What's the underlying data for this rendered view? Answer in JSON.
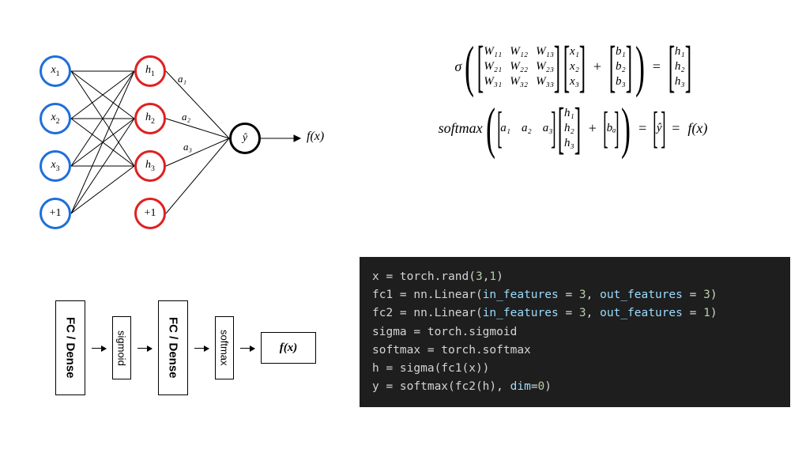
{
  "nn": {
    "input_layer": [
      {
        "label": "x",
        "sub": "1"
      },
      {
        "label": "x",
        "sub": "2"
      },
      {
        "label": "x",
        "sub": "3"
      },
      {
        "label": "+1",
        "sub": ""
      }
    ],
    "hidden_layer": [
      {
        "label": "h",
        "sub": "1"
      },
      {
        "label": "h",
        "sub": "2"
      },
      {
        "label": "h",
        "sub": "3"
      },
      {
        "label": "+1",
        "sub": ""
      }
    ],
    "output": {
      "label": "ŷ"
    },
    "edge_labels": {
      "a1": "a₁",
      "a2": "a₂",
      "a3": "a₃"
    },
    "output_label": "f(x)"
  },
  "blocks": {
    "fc1": "FC / Dense",
    "sigmoid": "sigmoid",
    "fc2": "FC / Dense",
    "softmax": "softmax",
    "out": "f(x)"
  },
  "eq": {
    "sigma": "σ",
    "softmax": "softmax",
    "W": [
      [
        "W₁₁",
        "W₁₂",
        "W₁₃"
      ],
      [
        "W₂₁",
        "W₂₂",
        "W₂₃"
      ],
      [
        "W₃₁",
        "W₃₂",
        "W₃₃"
      ]
    ],
    "x": [
      "x₁",
      "x₂",
      "x₃"
    ],
    "b": [
      "b₁",
      "b₂",
      "b₃"
    ],
    "h": [
      "h₁",
      "h₂",
      "h₃"
    ],
    "a": [
      "a₁",
      "a₂",
      "a₃"
    ],
    "ba": "bₐ",
    "yhat": "ŷ",
    "fx": "f(x)",
    "plus": "+",
    "eq": "="
  },
  "code": {
    "l1_a": "x = torch.rand(",
    "l1_b": "3",
    "l1_c": ",",
    "l1_d": "1",
    "l1_e": ")",
    "l2_a": "fc1 = nn.Linear(",
    "l2_b": "in_features",
    "l2_c": " = ",
    "l2_d": "3",
    "l2_e": ", ",
    "l2_f": "out_features",
    "l2_g": " = ",
    "l2_h": "3",
    "l2_i": ")",
    "l3_a": "fc2 = nn.Linear(",
    "l3_b": "in_features",
    "l3_c": " = ",
    "l3_d": "3",
    "l3_e": ", ",
    "l3_f": "out_features",
    "l3_g": " = ",
    "l3_h": "1",
    "l3_i": ")",
    "l4": "sigma = torch.sigmoid",
    "l5": "softmax = torch.softmax",
    "l6": "h = sigma(fc1(x))",
    "l7_a": "y = softmax(fc2(h), ",
    "l7_b": "dim",
    "l7_c": "=",
    "l7_d": "0",
    "l7_e": ")"
  }
}
